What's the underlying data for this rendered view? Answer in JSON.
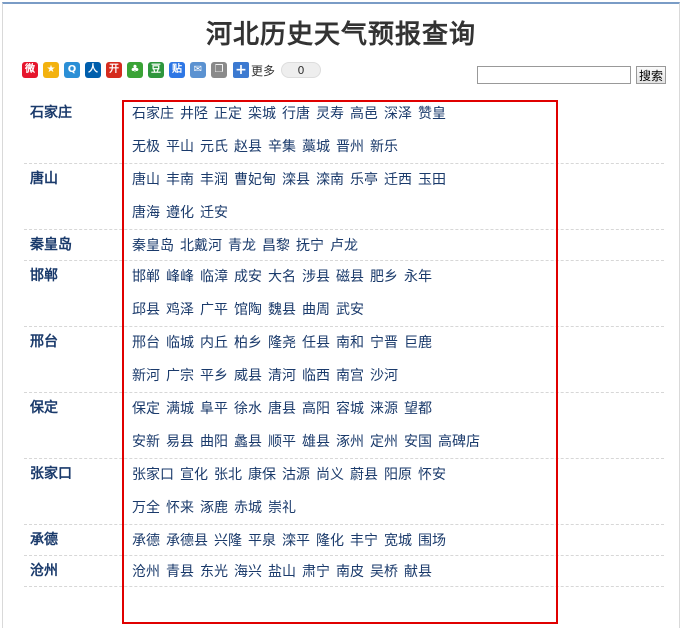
{
  "page": {
    "title": "河北历史天气预报查询"
  },
  "share": {
    "icons": [
      {
        "name": "weibo-icon",
        "glyph": "微",
        "color": "#e6162d"
      },
      {
        "name": "qzone-icon",
        "glyph": "★",
        "color": "#f3b20f"
      },
      {
        "name": "tqq-icon",
        "glyph": "Q",
        "color": "#2b8fd6"
      },
      {
        "name": "renren-icon",
        "glyph": "人",
        "color": "#005eac"
      },
      {
        "name": "kaixin-icon",
        "glyph": "开",
        "color": "#d52b1e"
      },
      {
        "name": "clover-icon",
        "glyph": "♣",
        "color": "#3aa336"
      },
      {
        "name": "douban-icon",
        "glyph": "豆",
        "color": "#2e963d"
      },
      {
        "name": "tieba-icon",
        "glyph": "贴",
        "color": "#2e77e5"
      },
      {
        "name": "mail-icon",
        "glyph": "✉",
        "color": "#5b92d1"
      },
      {
        "name": "copy-icon",
        "glyph": "❐",
        "color": "#8a8a8a"
      }
    ],
    "more_label": "更多",
    "count": "0"
  },
  "search": {
    "value": "",
    "button_label": "搜索"
  },
  "regions": [
    {
      "name": "石家庄",
      "rows": [
        [
          "石家庄",
          "井陉",
          "正定",
          "栾城",
          "行唐",
          "灵寿",
          "高邑",
          "深泽",
          "赞皇"
        ],
        [
          "无极",
          "平山",
          "元氏",
          "赵县",
          "辛集",
          "藁城",
          "晋州",
          "新乐"
        ]
      ]
    },
    {
      "name": "唐山",
      "rows": [
        [
          "唐山",
          "丰南",
          "丰润",
          "曹妃甸",
          "滦县",
          "滦南",
          "乐亭",
          "迁西",
          "玉田"
        ],
        [
          "唐海",
          "遵化",
          "迁安"
        ]
      ]
    },
    {
      "name": "秦皇岛",
      "rows": [
        [
          "秦皇岛",
          "北戴河",
          "青龙",
          "昌黎",
          "抚宁",
          "卢龙"
        ]
      ]
    },
    {
      "name": "邯郸",
      "rows": [
        [
          "邯郸",
          "峰峰",
          "临漳",
          "成安",
          "大名",
          "涉县",
          "磁县",
          "肥乡",
          "永年"
        ],
        [
          "邱县",
          "鸡泽",
          "广平",
          "馆陶",
          "魏县",
          "曲周",
          "武安"
        ]
      ]
    },
    {
      "name": "邢台",
      "rows": [
        [
          "邢台",
          "临城",
          "内丘",
          "柏乡",
          "隆尧",
          "任县",
          "南和",
          "宁晋",
          "巨鹿"
        ],
        [
          "新河",
          "广宗",
          "平乡",
          "威县",
          "清河",
          "临西",
          "南宫",
          "沙河"
        ]
      ]
    },
    {
      "name": "保定",
      "rows": [
        [
          "保定",
          "满城",
          "阜平",
          "徐水",
          "唐县",
          "高阳",
          "容城",
          "涞源",
          "望都"
        ],
        [
          "安新",
          "易县",
          "曲阳",
          "蠡县",
          "顺平",
          "雄县",
          "涿州",
          "定州",
          "安国",
          "高碑店"
        ]
      ]
    },
    {
      "name": "张家口",
      "rows": [
        [
          "张家口",
          "宣化",
          "张北",
          "康保",
          "沽源",
          "尚义",
          "蔚县",
          "阳原",
          "怀安"
        ],
        [
          "万全",
          "怀来",
          "涿鹿",
          "赤城",
          "崇礼"
        ]
      ]
    },
    {
      "name": "承德",
      "rows": [
        [
          "承德",
          "承德县",
          "兴隆",
          "平泉",
          "滦平",
          "隆化",
          "丰宁",
          "宽城",
          "围场"
        ]
      ]
    },
    {
      "name": "沧州",
      "rows": [
        [
          "沧州",
          "青县",
          "东光",
          "海兴",
          "盐山",
          "肃宁",
          "南皮",
          "吴桥",
          "献县"
        ]
      ]
    }
  ]
}
